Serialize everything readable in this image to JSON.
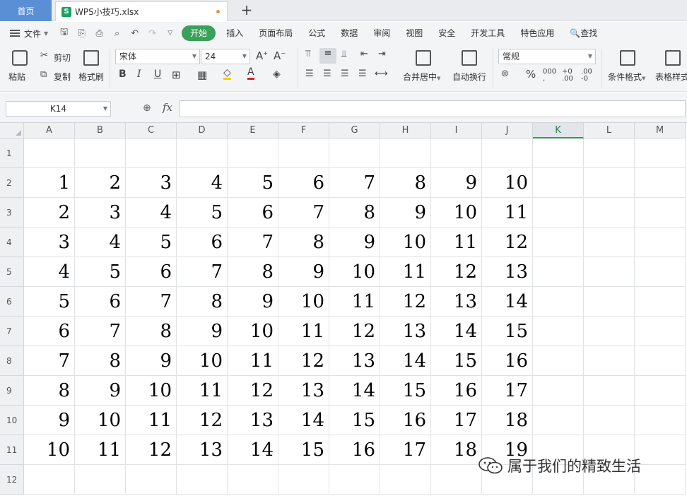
{
  "tabs": {
    "home": "首页",
    "file": "WPS小技巧.xlsx",
    "new_tab": "+"
  },
  "menu": {
    "file": "文件",
    "items": [
      "开始",
      "插入",
      "页面布局",
      "公式",
      "数据",
      "审阅",
      "视图",
      "安全",
      "开发工具",
      "特色应用",
      "查找"
    ],
    "active": "开始"
  },
  "ribbon": {
    "paste": "粘贴",
    "cut": "剪切",
    "copy": "复制",
    "format_painter": "格式刷",
    "font_name": "宋体",
    "font_size": "24",
    "merge_center": "合并居中",
    "wrap_text": "自动换行",
    "number_format": "常规",
    "percent": "%",
    "conditional_format": "条件格式",
    "table_style": "表格样式"
  },
  "formula_bar": {
    "name_box": "K14",
    "fx": "fx",
    "value": ""
  },
  "grid": {
    "columns": [
      "A",
      "B",
      "C",
      "D",
      "E",
      "F",
      "G",
      "H",
      "I",
      "J",
      "K",
      "L",
      "M"
    ],
    "active_column": "K",
    "rows": [
      "1",
      "2",
      "3",
      "4",
      "5",
      "6",
      "7",
      "8",
      "9",
      "10",
      "11",
      "12"
    ],
    "cells": [
      [],
      [
        "1",
        "2",
        "3",
        "4",
        "5",
        "6",
        "7",
        "8",
        "9",
        "10"
      ],
      [
        "2",
        "3",
        "4",
        "5",
        "6",
        "7",
        "8",
        "9",
        "10",
        "11"
      ],
      [
        "3",
        "4",
        "5",
        "6",
        "7",
        "8",
        "9",
        "10",
        "11",
        "12"
      ],
      [
        "4",
        "5",
        "6",
        "7",
        "8",
        "9",
        "10",
        "11",
        "12",
        "13"
      ],
      [
        "5",
        "6",
        "7",
        "8",
        "9",
        "10",
        "11",
        "12",
        "13",
        "14"
      ],
      [
        "6",
        "7",
        "8",
        "9",
        "10",
        "11",
        "12",
        "13",
        "14",
        "15"
      ],
      [
        "7",
        "8",
        "9",
        "10",
        "11",
        "12",
        "13",
        "14",
        "15",
        "16"
      ],
      [
        "8",
        "9",
        "10",
        "11",
        "12",
        "13",
        "14",
        "15",
        "16",
        "17"
      ],
      [
        "9",
        "10",
        "11",
        "12",
        "13",
        "14",
        "15",
        "16",
        "17",
        "18"
      ],
      [
        "10",
        "11",
        "12",
        "13",
        "14",
        "15",
        "16",
        "17",
        "18",
        "19"
      ],
      []
    ]
  },
  "watermark": "属于我们的精致生活"
}
